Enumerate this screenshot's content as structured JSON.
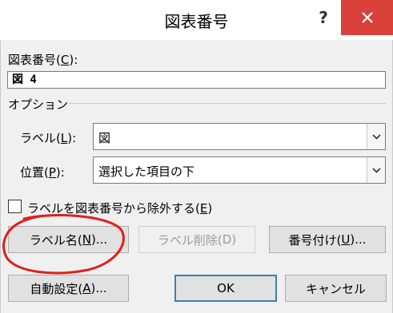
{
  "window": {
    "title": "図表番号",
    "help_glyph": "?",
    "close_icon": "close-icon"
  },
  "caption": {
    "label_prefix": "図表番号(",
    "label_key": "C",
    "label_suffix": "):",
    "value": "図 4"
  },
  "options": {
    "group_label": "オプション",
    "label_field": {
      "label_prefix": "ラベル(",
      "label_key": "L",
      "label_suffix": "):",
      "value": "図"
    },
    "position_field": {
      "label_prefix": "位置(",
      "label_key": "P",
      "label_suffix": "):",
      "value": "選択した項目の下"
    }
  },
  "exclude_checkbox": {
    "label_prefix": "ラベルを図表番号から除外する(",
    "label_key": "E",
    "label_suffix": ")",
    "checked": false
  },
  "buttons": {
    "new_label": {
      "prefix": "ラベル名(",
      "key": "N",
      "suffix": ")..."
    },
    "delete_label": {
      "prefix": "ラベル削除(",
      "key": "D",
      "suffix": ")"
    },
    "numbering": {
      "prefix": "番号付け(",
      "key": "U",
      "suffix": ")..."
    },
    "autocaption": {
      "prefix": "自動設定(",
      "key": "A",
      "suffix": ")..."
    },
    "ok": "OK",
    "cancel": "キャンセル"
  },
  "colors": {
    "close_red": "#d9413a",
    "annotation_red": "#e0201b",
    "default_button_border": "#3c7fb1"
  }
}
